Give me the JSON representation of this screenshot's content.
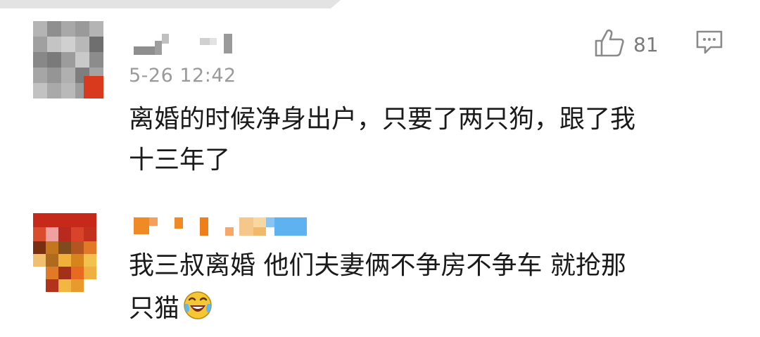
{
  "comments": [
    {
      "timestamp": "5-26 12:42",
      "text_line1": "离婚的时候净身出户，只要了两只狗，跟了我",
      "text_line2": "十三年了",
      "like_count": "81",
      "like_icon": "thumbs-up-icon",
      "reply_icon": "comment-bubble-icon"
    },
    {
      "text_line1": "我三叔离婚 他们夫妻俩不争房不争车 就抢那",
      "text_line2": "只猫",
      "emoji_icon": "laughing-crying-emoji-icon"
    }
  ],
  "colors": {
    "text": "#1a1a1a",
    "meta": "#9a9a9a",
    "icon": "#8a8a8a",
    "avatar_red": "#d9391c",
    "username_orange": "#f08a24",
    "username_blue": "#5fb2f0"
  }
}
